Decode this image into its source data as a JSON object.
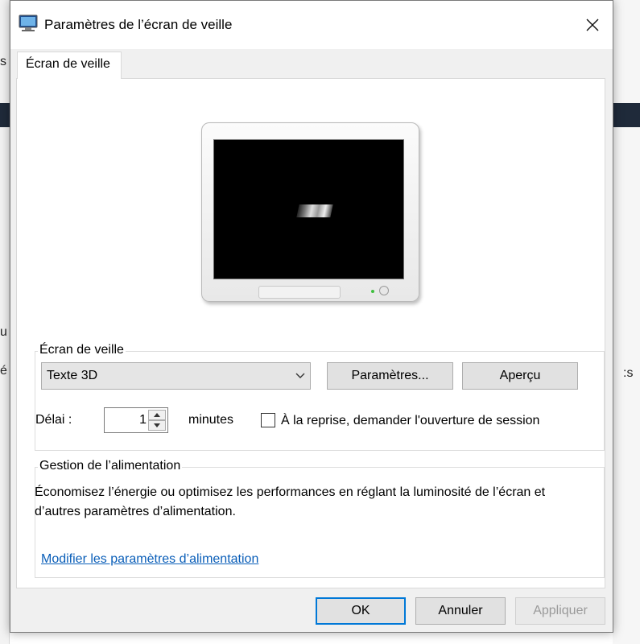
{
  "background": {
    "left_fragment": "s",
    "right_fragment": ":s",
    "left_fragment_2": "u",
    "left_fragment_3": "é"
  },
  "dialog": {
    "title": "Paramètres de l’écran de veille",
    "close_icon": "close-icon",
    "tab_label": "Écran de veille"
  },
  "screensaver": {
    "group_label": "Écran de veille",
    "selected": "Texte 3D",
    "settings_button": "Paramètres...",
    "preview_button": "Aperçu",
    "delay_label": "Délai :",
    "delay_value": "1",
    "minutes_label": "minutes",
    "resume_checkbox_label": "À la reprise, demander l'ouverture de session",
    "resume_checked": false
  },
  "power": {
    "group_label": "Gestion de l’alimentation",
    "description": "Économisez l’énergie ou optimisez les performances en réglant la luminosité de l’écran et d’autres paramètres d’alimentation.",
    "link": "Modifier les paramètres d’alimentation"
  },
  "footer": {
    "ok": "OK",
    "cancel": "Annuler",
    "apply": "Appliquer"
  },
  "colors": {
    "accent": "#0078d7",
    "link": "#0a5eb8",
    "disabled_text": "#9a9a9a"
  }
}
